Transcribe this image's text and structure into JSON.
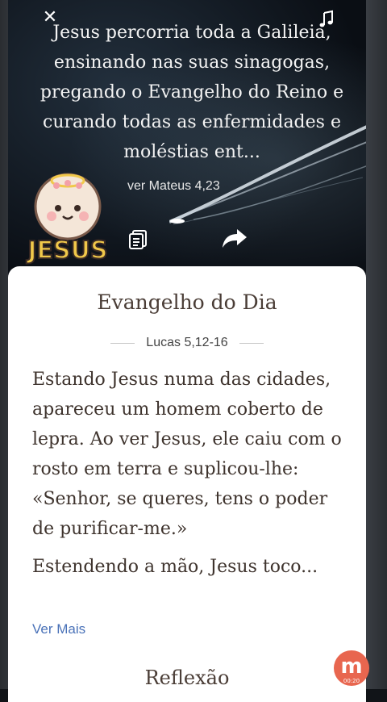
{
  "hero": {
    "verse_text": "Jesus percorria toda a Galileia, ensinando nas suas sinagogas, pregando o Evangelho do Reino e curando todas as enfermidades e moléstias ent...",
    "verse_reference": "ver Mateus 4,23",
    "logo_text": "JESUS",
    "icons": [
      "close-icon",
      "music-note-icon",
      "copy-icon",
      "share-icon"
    ]
  },
  "card": {
    "title": "Evangelho do Dia",
    "reference": "Lucas 5,12-16",
    "paragraphs": [
      "Estando Jesus numa das cidades, apareceu um homem coberto de lepra. Ao ver Jesus, ele caiu com o rosto em terra e suplicou-lhe: «Senhor, se queres, tens o poder de purificar-me.»",
      "Estendendo a mão, Jesus toco..."
    ],
    "see_more_label": "Ver Mais",
    "next_section_title": "Reflexão"
  },
  "recorder": {
    "badge_letter": "m",
    "time": "00:20"
  },
  "colors": {
    "card_background": "#ffffff",
    "title_text": "#4a3d36",
    "link": "#4a72b8",
    "recorder_badge": "#e8664f"
  }
}
